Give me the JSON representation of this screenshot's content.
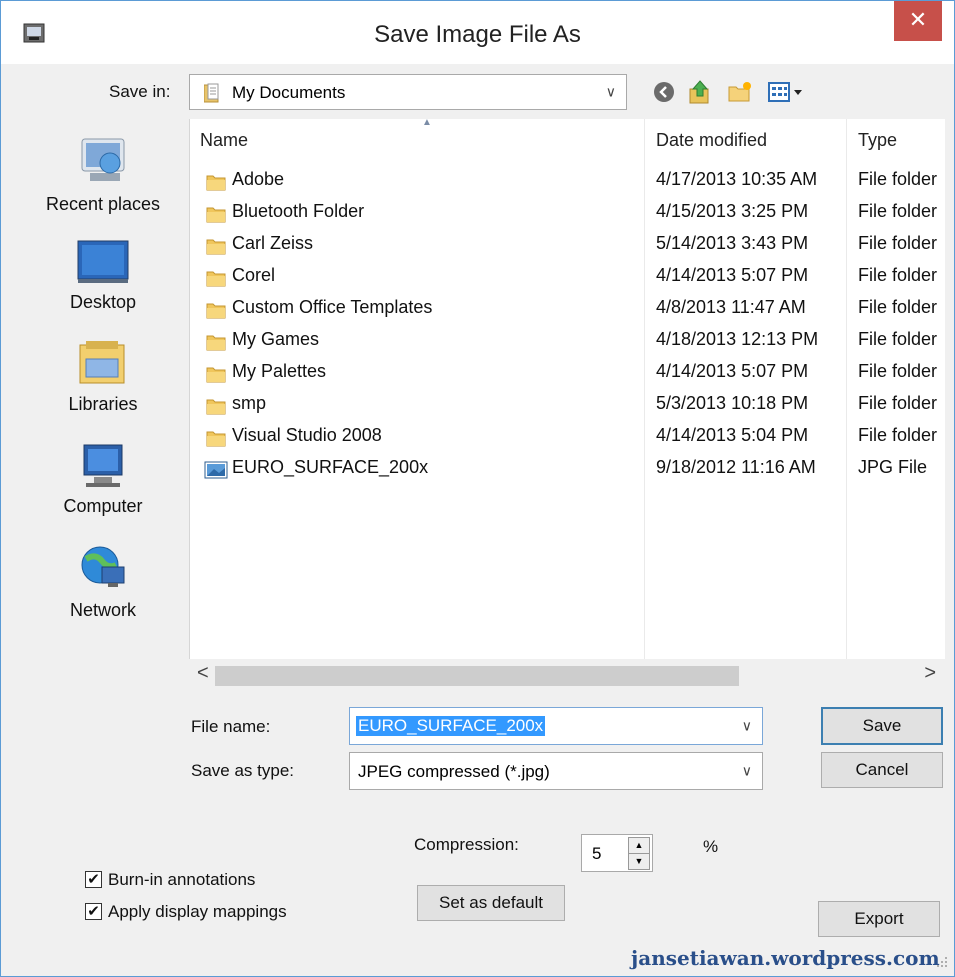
{
  "window": {
    "title": "Save Image File As",
    "close_glyph": "✕"
  },
  "save_in": {
    "label": "Save in:",
    "value": "My Documents",
    "dropdown_glyph": "∨"
  },
  "toolbar": {
    "back_icon": "back-icon",
    "up_icon": "up-folder-icon",
    "new_folder_icon": "new-folder-icon",
    "views_icon": "views-menu-icon"
  },
  "places": [
    {
      "label": "Recent places"
    },
    {
      "label": "Desktop"
    },
    {
      "label": "Libraries"
    },
    {
      "label": "Computer"
    },
    {
      "label": "Network"
    }
  ],
  "columns": {
    "name": "Name",
    "date": "Date modified",
    "type": "Type",
    "sort_glyph": "▲"
  },
  "files": [
    {
      "name": "Adobe",
      "date": "4/17/2013 10:35 AM",
      "type": "File folder",
      "kind": "folder"
    },
    {
      "name": "Bluetooth Folder",
      "date": "4/15/2013 3:25 PM",
      "type": "File folder",
      "kind": "folder"
    },
    {
      "name": "Carl Zeiss",
      "date": "5/14/2013 3:43 PM",
      "type": "File folder",
      "kind": "folder"
    },
    {
      "name": "Corel",
      "date": "4/14/2013 5:07 PM",
      "type": "File folder",
      "kind": "folder"
    },
    {
      "name": "Custom Office Templates",
      "date": "4/8/2013 11:47 AM",
      "type": "File folder",
      "kind": "folder"
    },
    {
      "name": "My Games",
      "date": "4/18/2013 12:13 PM",
      "type": "File folder",
      "kind": "folder"
    },
    {
      "name": "My Palettes",
      "date": "4/14/2013 5:07 PM",
      "type": "File folder",
      "kind": "folder"
    },
    {
      "name": "smp",
      "date": "5/3/2013 10:18 PM",
      "type": "File folder",
      "kind": "folder"
    },
    {
      "name": "Visual Studio 2008",
      "date": "4/14/2013 5:04 PM",
      "type": "File folder",
      "kind": "folder"
    },
    {
      "name": "EURO_SURFACE_200x",
      "date": "9/18/2012 11:16 AM",
      "type": "JPG File",
      "kind": "jpg"
    }
  ],
  "scroll": {
    "left_glyph": "<",
    "right_glyph": ">"
  },
  "file_name": {
    "label": "File name:",
    "value": "EURO_SURFACE_200x",
    "dropdown_glyph": "∨"
  },
  "save_type": {
    "label": "Save as type:",
    "value": "JPEG compressed (*.jpg)",
    "dropdown_glyph": "∨"
  },
  "buttons": {
    "save": "Save",
    "cancel": "Cancel",
    "set_default": "Set as default",
    "export": "Export"
  },
  "compression": {
    "label": "Compression:",
    "value": "5",
    "unit": "%",
    "up_glyph": "▲",
    "down_glyph": "▼"
  },
  "options": {
    "burn_in": {
      "label": "Burn-in annotations",
      "checked": true
    },
    "display_mappings": {
      "label": "Apply display mappings",
      "checked": true
    },
    "check_glyph": "✔"
  },
  "watermark": "jansetiawan.wordpress.com",
  "colors": {
    "accent": "#3c7fb1",
    "selection": "#3399ff",
    "close": "#c7504a"
  }
}
